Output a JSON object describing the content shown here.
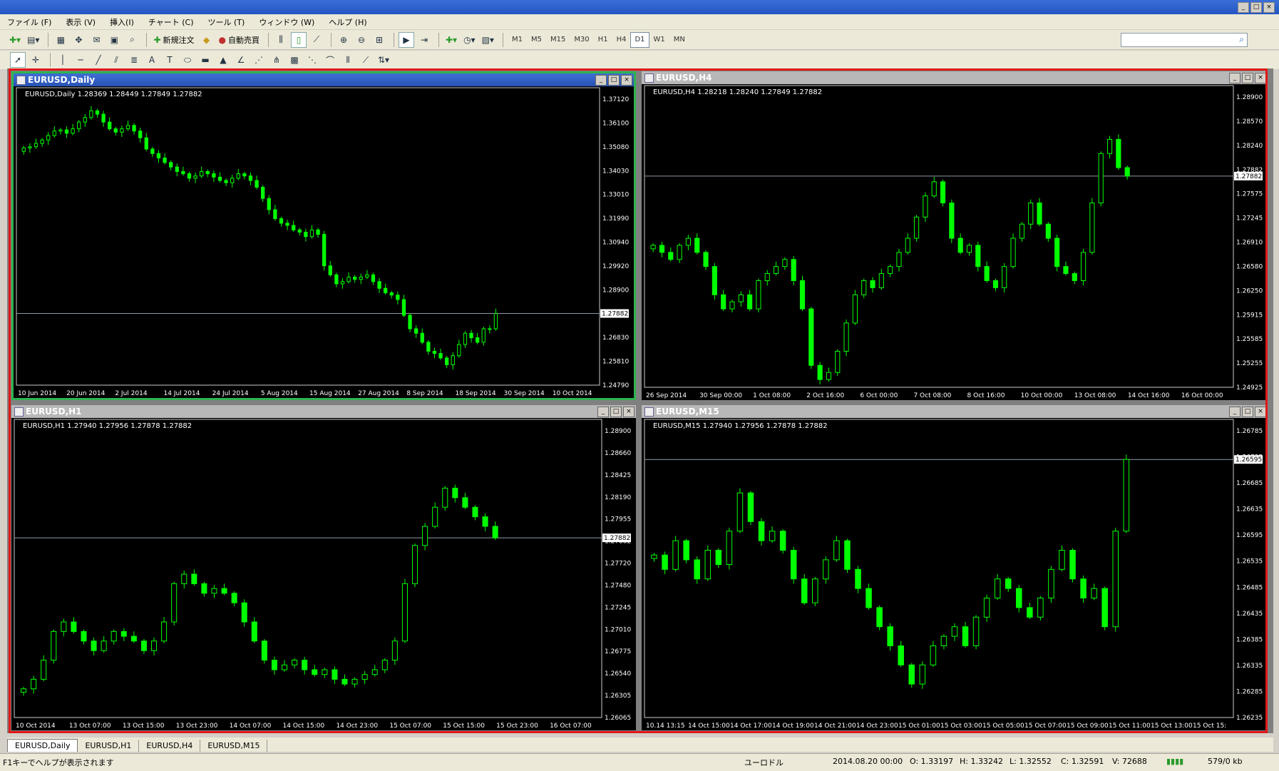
{
  "menu": [
    "ファイル (F)",
    "表示 (V)",
    "挿入(I)",
    "チャート (C)",
    "ツール (T)",
    "ウィンドウ (W)",
    "ヘルプ (H)"
  ],
  "toolbar": {
    "new_order": "新規注文",
    "auto_trade": "自動売買"
  },
  "timeframes": [
    "M1",
    "M5",
    "M15",
    "M30",
    "H1",
    "H4",
    "D1",
    "W1",
    "MN"
  ],
  "active_timeframe": "D1",
  "search": {
    "placeholder": ""
  },
  "colors": {
    "candle": "#00ff00",
    "bg": "#000000",
    "grid_line": "#8c9aa8",
    "frame": "#e01818",
    "axis_text": "#ffffff"
  },
  "charts": [
    {
      "title": "EURUSD,Daily",
      "active": true,
      "ohlc_label": "EURUSD,Daily  1.28369 1.28449 1.27849 1.27882",
      "price_ticks": [
        "1.37120",
        "1.36100",
        "1.35080",
        "1.34030",
        "1.33010",
        "1.31990",
        "1.30940",
        "1.29920",
        "1.28900",
        "1.27882",
        "1.26830",
        "1.25810",
        "1.24790"
      ],
      "current_price": "1.27882",
      "time_ticks": [
        "10 Jun 2014",
        "20 Jun 2014",
        "2 Jul 2014",
        "14 Jul 2014",
        "24 Jul 2014",
        "5 Aug 2014",
        "15 Aug 2014",
        "27 Aug 2014",
        "8 Sep 2014",
        "18 Sep 2014",
        "30 Sep 2014",
        "10 Oct 2014"
      ],
      "ymin": 1.2469,
      "ymax": 1.3742,
      "chart_data": {
        "type": "line",
        "values": [
          1.3525,
          1.353,
          1.3545,
          1.356,
          1.358,
          1.36,
          1.3605,
          1.359,
          1.361,
          1.364,
          1.366,
          1.369,
          1.3675,
          1.364,
          1.361,
          1.3595,
          1.361,
          1.3625,
          1.36,
          1.357,
          1.352,
          1.35,
          1.348,
          1.346,
          1.344,
          1.342,
          1.341,
          1.339,
          1.34,
          1.342,
          1.341,
          1.3395,
          1.338,
          1.337,
          1.339,
          1.341,
          1.34,
          1.338,
          1.335,
          1.33,
          1.325,
          1.321,
          1.319,
          1.318,
          1.316,
          1.315,
          1.313,
          1.316,
          1.314,
          1.3,
          1.296,
          1.292,
          1.293,
          1.295,
          1.294,
          1.295,
          1.296,
          1.293,
          1.29,
          1.288,
          1.287,
          1.285,
          1.278,
          1.272,
          1.27,
          1.266,
          1.262,
          1.261,
          1.259,
          1.256,
          1.26,
          1.265,
          1.27,
          1.268,
          1.266,
          1.272,
          1.272,
          1.2788
        ]
      }
    },
    {
      "title": "EURUSD,H4",
      "active": false,
      "ohlc_label": "EURUSD,H4  1.28218 1.28240 1.27849 1.27882",
      "price_ticks": [
        "1.28900",
        "1.28570",
        "1.28240",
        "1.27882",
        "1.27575",
        "1.27245",
        "1.26910",
        "1.26580",
        "1.26250",
        "1.25915",
        "1.25585",
        "1.25255",
        "1.24925"
      ],
      "current_price": "1.27882",
      "time_ticks": [
        "26 Sep 2014",
        "30 Sep 00:00",
        "1 Oct 08:00",
        "2 Oct 16:00",
        "6 Oct 00:00",
        "7 Oct 08:00",
        "8 Oct 16:00",
        "10 Oct 00:00",
        "13 Oct 08:00",
        "14 Oct 16:00",
        "16 Oct 00:00"
      ],
      "ymin": 1.2489,
      "ymax": 1.29,
      "chart_data": {
        "type": "line",
        "values": [
          1.269,
          1.268,
          1.267,
          1.269,
          1.27,
          1.268,
          1.266,
          1.262,
          1.26,
          1.261,
          1.262,
          1.26,
          1.264,
          1.265,
          1.266,
          1.267,
          1.264,
          1.26,
          1.252,
          1.25,
          1.251,
          1.254,
          1.258,
          1.262,
          1.264,
          1.263,
          1.265,
          1.266,
          1.268,
          1.27,
          1.273,
          1.276,
          1.278,
          1.275,
          1.27,
          1.268,
          1.269,
          1.266,
          1.264,
          1.263,
          1.266,
          1.27,
          1.272,
          1.275,
          1.272,
          1.27,
          1.266,
          1.265,
          1.264,
          1.268,
          1.275,
          1.282,
          1.284,
          1.28,
          1.2788
        ]
      }
    },
    {
      "title": "EURUSD,H1",
      "active": false,
      "ohlc_label": "EURUSD,H1  1.27940 1.27956 1.27878 1.27882",
      "price_ticks": [
        "1.28900",
        "1.28660",
        "1.28425",
        "1.28190",
        "1.27955",
        "1.27882",
        "1.27720",
        "1.27480",
        "1.27245",
        "1.27010",
        "1.26775",
        "1.26540",
        "1.26305",
        "1.26065"
      ],
      "current_price": "1.27882",
      "time_ticks": [
        "10 Oct 2014",
        "13 Oct 07:00",
        "13 Oct 15:00",
        "13 Oct 23:00",
        "14 Oct 07:00",
        "14 Oct 15:00",
        "14 Oct 23:00",
        "15 Oct 07:00",
        "15 Oct 15:00",
        "15 Oct 23:00",
        "16 Oct 07:00"
      ],
      "ymin": 1.26,
      "ymax": 1.29,
      "chart_data": {
        "type": "line",
        "values": [
          1.263,
          1.264,
          1.266,
          1.269,
          1.27,
          1.269,
          1.268,
          1.267,
          1.268,
          1.269,
          1.2685,
          1.268,
          1.267,
          1.268,
          1.27,
          1.274,
          1.275,
          1.274,
          1.273,
          1.2735,
          1.273,
          1.272,
          1.27,
          1.268,
          1.266,
          1.265,
          1.2655,
          1.266,
          1.265,
          1.2645,
          1.265,
          1.264,
          1.2635,
          1.264,
          1.2645,
          1.265,
          1.266,
          1.268,
          1.274,
          1.278,
          1.28,
          1.282,
          1.284,
          1.283,
          1.282,
          1.281,
          1.28,
          1.2788
        ]
      }
    },
    {
      "title": "EURUSD,M15",
      "active": false,
      "ohlc_label": "EURUSD,M15  1.27940 1.27956 1.27878 1.27882",
      "price_ticks": [
        "1.26785",
        "1.26735",
        "1.26685",
        "1.26635",
        "1.26595",
        "1.26535",
        "1.26485",
        "1.26435",
        "1.26385",
        "1.26335",
        "1.26285",
        "1.26235"
      ],
      "current_price": "1.26595",
      "time_ticks": [
        "10.14 13:15",
        "14 Oct 15:00",
        "14 Oct 17:00",
        "14 Oct 19:00",
        "14 Oct 21:00",
        "14 Oct 23:00",
        "15 Oct 01:00",
        "15 Oct 03:00",
        "15 Oct 05:00",
        "15 Oct 07:00",
        "15 Oct 09:00",
        "15 Oct 11:00",
        "15 Oct 13:00",
        "15 Oct 15:"
      ],
      "ymin": 1.2621,
      "ymax": 1.2681,
      "chart_data": {
        "type": "line",
        "values": [
          1.2655,
          1.2652,
          1.2658,
          1.2654,
          1.265,
          1.2656,
          1.2653,
          1.266,
          1.2668,
          1.2662,
          1.2658,
          1.266,
          1.2656,
          1.265,
          1.2645,
          1.265,
          1.2654,
          1.2658,
          1.2652,
          1.2648,
          1.2644,
          1.264,
          1.2636,
          1.2632,
          1.2628,
          1.2632,
          1.2636,
          1.2638,
          1.264,
          1.2636,
          1.2642,
          1.2646,
          1.265,
          1.2648,
          1.2644,
          1.2642,
          1.2646,
          1.2652,
          1.2656,
          1.265,
          1.2646,
          1.2648,
          1.264,
          1.266,
          1.2675
        ]
      }
    }
  ],
  "tabs": [
    "EURUSD,Daily",
    "EURUSD,H1",
    "EURUSD,H4",
    "EURUSD,M15"
  ],
  "status": {
    "help": "F1キーでヘルプが表示されます",
    "symbol": "ユーロドル",
    "datetime": "2014.08.20 00:00",
    "open": "O: 1.33197",
    "high": "H: 1.33242",
    "low": "L: 1.32552",
    "close": "C: 1.32591",
    "volume": "V: 72688",
    "traffic": "579/0 kb"
  }
}
